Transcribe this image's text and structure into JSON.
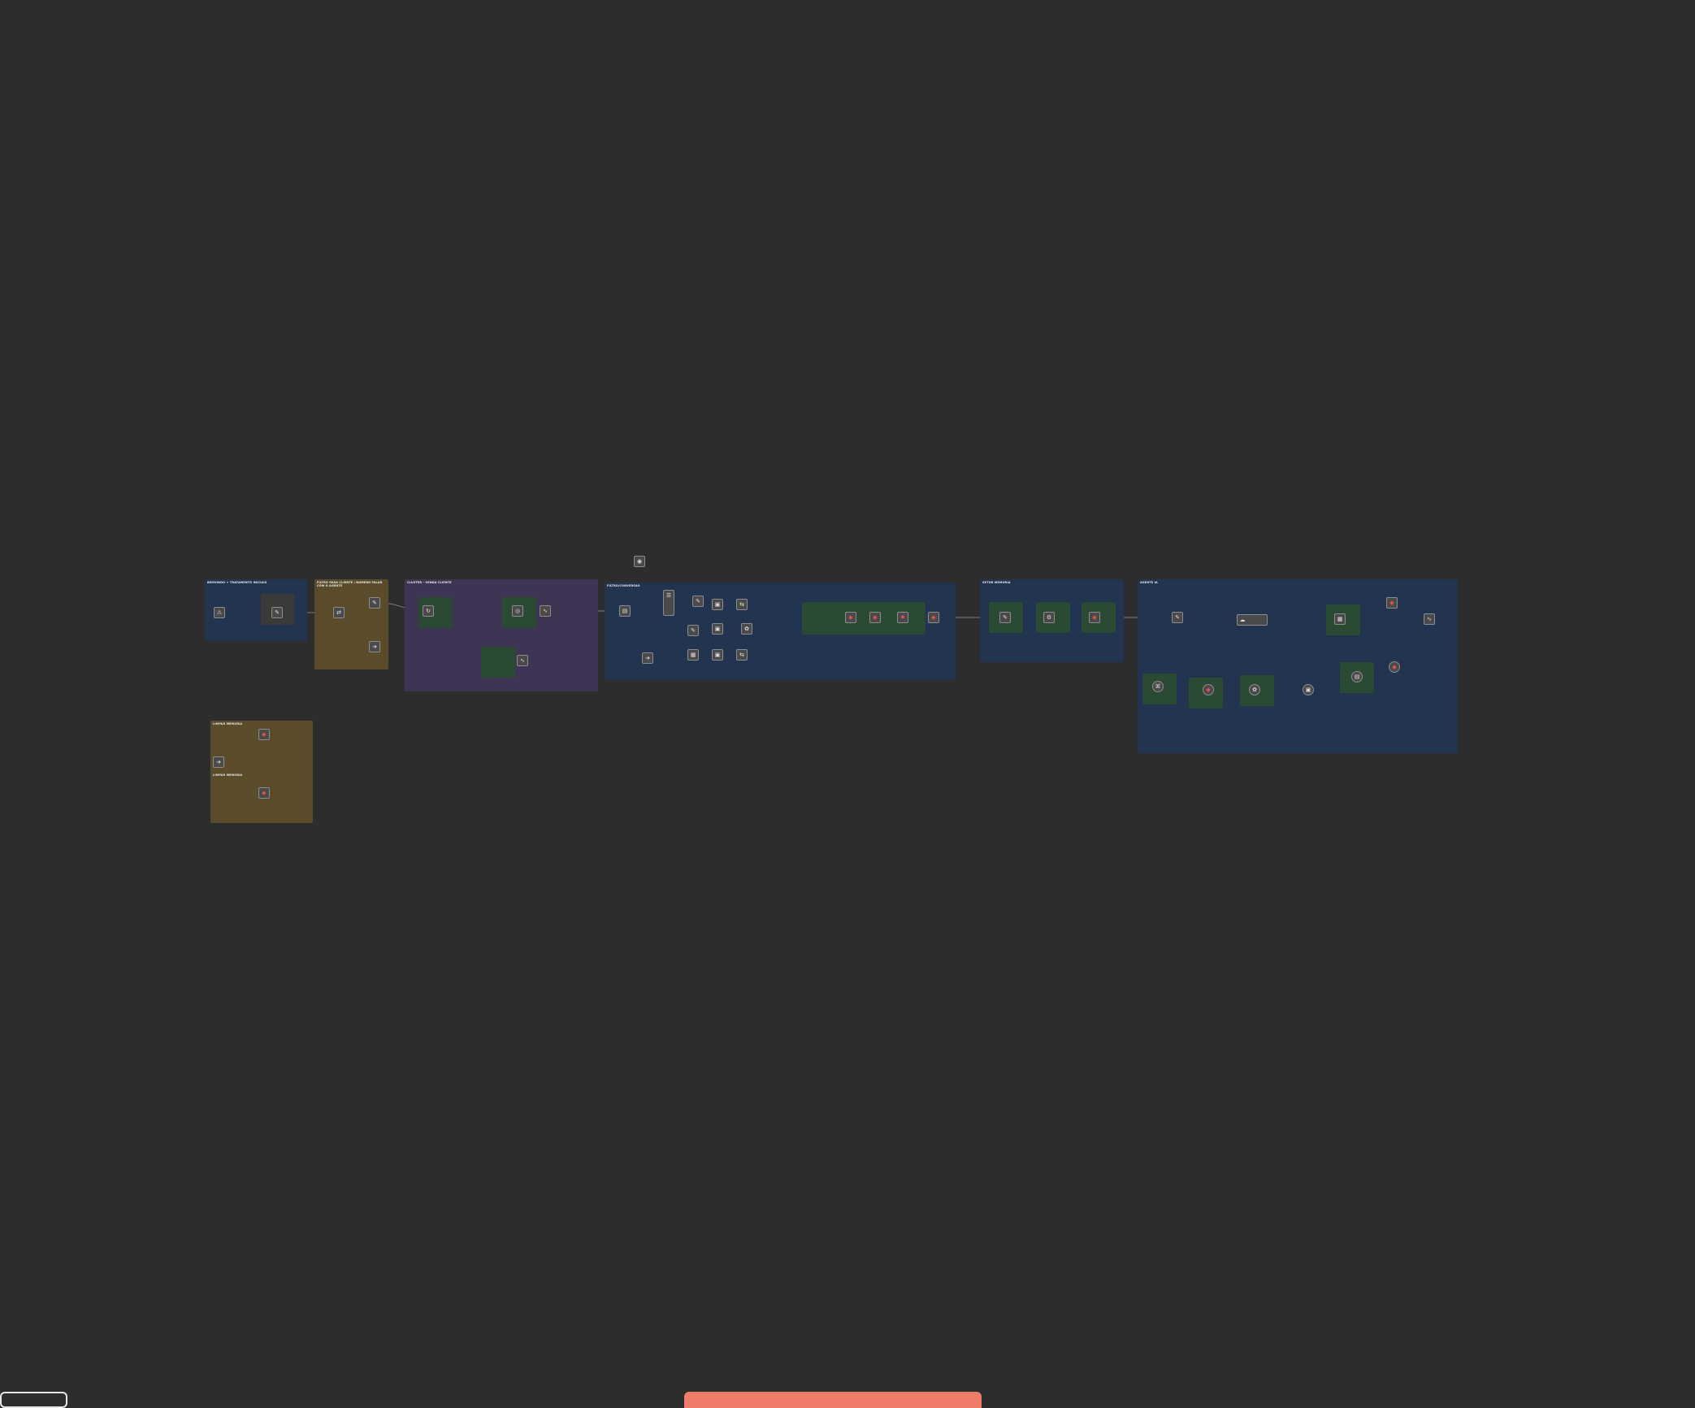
{
  "groups": {
    "g1": "BEMVINDO + TRATAMENTO INICIAIS",
    "g2": "FILTRO PARA CLIENTE / NUMERO FALAR COM O AGENTE",
    "g3": "CLUSTER - VENDA CLIENTE",
    "g4": "FILTRO/CONVERSAO",
    "g5": "SETOR MEMORIA",
    "g6": "AGENTE IA",
    "g7": "LIMPAR MEMORIA",
    "g8": "LIMPAR MEMORIA"
  },
  "colors": {
    "background": "#2d2d2d",
    "group_blue": "#22344f",
    "group_yellow": "#5a4b2a",
    "group_purple": "#3d3553",
    "group_green": "#2a4a33",
    "accent_bar": "#ef7b6b"
  }
}
